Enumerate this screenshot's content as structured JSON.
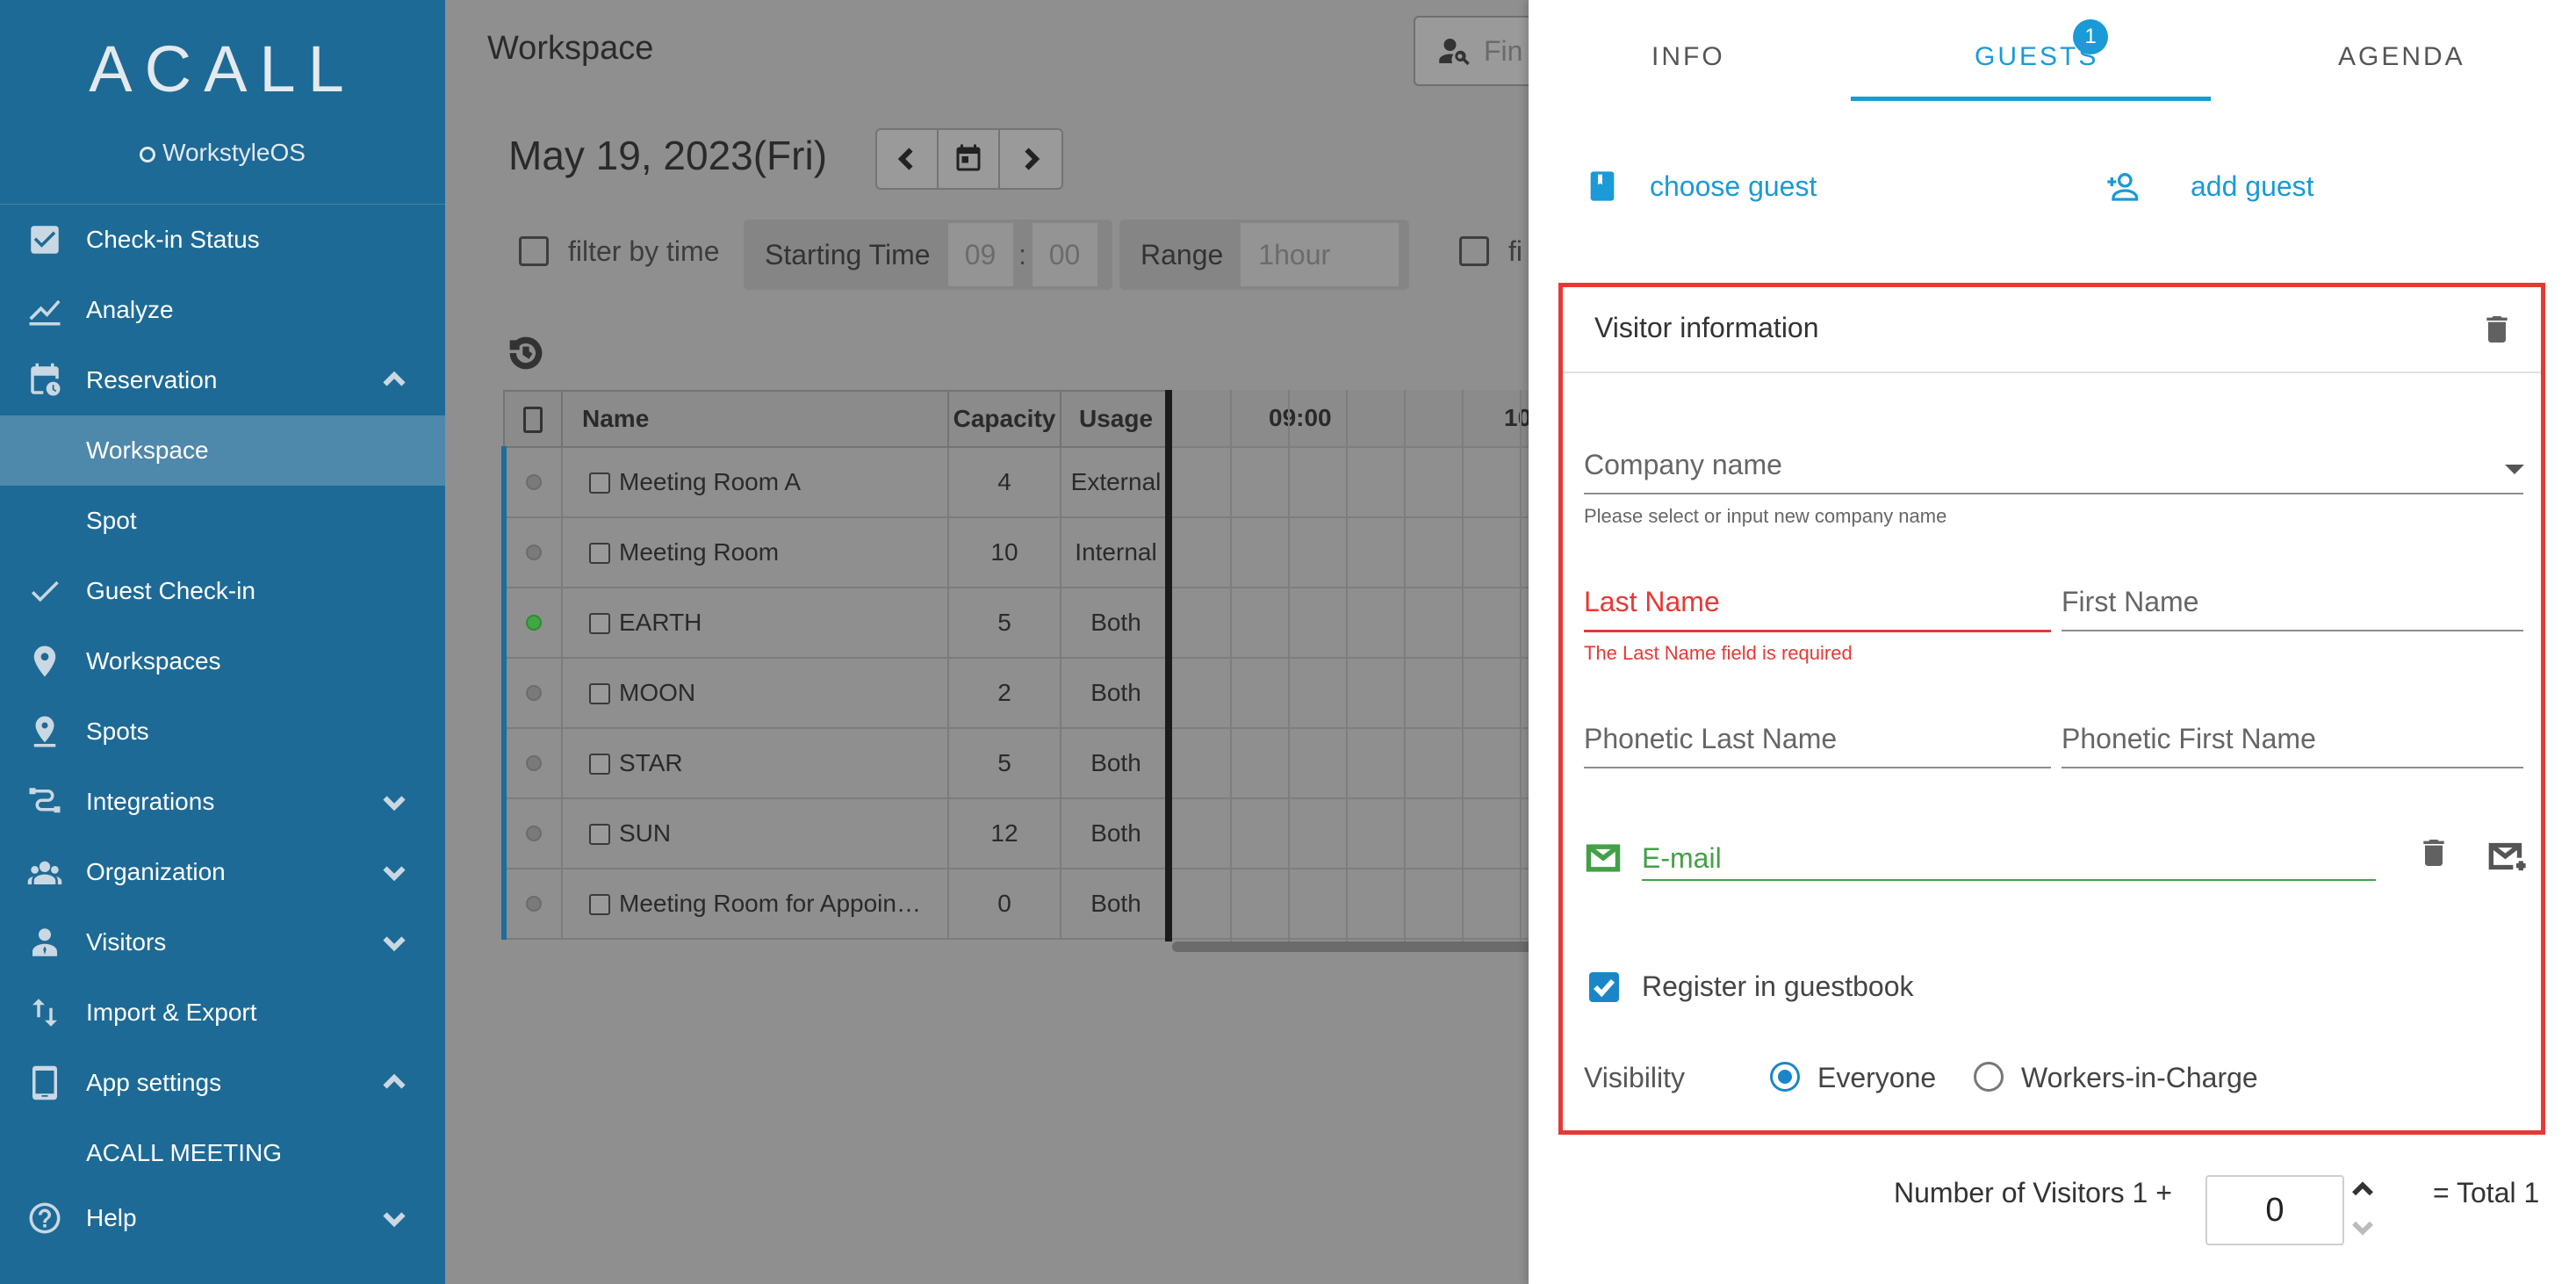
{
  "sidebar": {
    "logo": "ACALL",
    "sublogo": "WorkstyleOS",
    "items": [
      {
        "label": "Check-in Status",
        "icon": "checkbox-icon"
      },
      {
        "label": "Analyze",
        "icon": "chart-line-icon"
      },
      {
        "label": "Reservation",
        "icon": "calendar-clock-icon",
        "chevron": "up"
      },
      {
        "label": "Workspace",
        "sub": true,
        "active": true
      },
      {
        "label": "Spot",
        "sub": true
      },
      {
        "label": "Guest Check-in",
        "icon": "check-icon"
      },
      {
        "label": "Workspaces",
        "icon": "map-pin-icon"
      },
      {
        "label": "Spots",
        "icon": "person-pin-icon"
      },
      {
        "label": "Integrations",
        "icon": "integrations-icon",
        "chevron": "down"
      },
      {
        "label": "Organization",
        "icon": "group-icon",
        "chevron": "down"
      },
      {
        "label": "Visitors",
        "icon": "visitor-icon",
        "chevron": "down"
      },
      {
        "label": "Import & Export",
        "icon": "import-export-icon"
      },
      {
        "label": "App settings",
        "icon": "tablet-icon",
        "chevron": "up"
      },
      {
        "label": "ACALL MEETING",
        "sub": true
      },
      {
        "label": "Help",
        "icon": "help-icon",
        "chevron": "down"
      }
    ]
  },
  "main": {
    "title": "Workspace",
    "search_placeholder": "Fin",
    "date": "May 19, 2023(Fri)",
    "filter_by_time": "filter by time",
    "starting_time_label": "Starting Time",
    "start_hour": "09",
    "start_sep": ":",
    "start_min": "00",
    "range_label": "Range",
    "range_value": "1hour",
    "filter_cut": "fi",
    "table": {
      "headers": [
        "Name",
        "Capacity",
        "Usage"
      ],
      "time_header": "09:00",
      "time_header2": "10",
      "rows": [
        {
          "name": "Meeting Room A",
          "capacity": "4",
          "usage": "External",
          "status": "grey"
        },
        {
          "name": "Meeting Room",
          "capacity": "10",
          "usage": "Internal",
          "status": "grey"
        },
        {
          "name": "EARTH",
          "capacity": "5",
          "usage": "Both",
          "status": "green"
        },
        {
          "name": "MOON",
          "capacity": "2",
          "usage": "Both",
          "status": "grey"
        },
        {
          "name": "STAR",
          "capacity": "5",
          "usage": "Both",
          "status": "grey"
        },
        {
          "name": "SUN",
          "capacity": "12",
          "usage": "Both",
          "status": "grey"
        },
        {
          "name": "Meeting Room for Appoin…",
          "capacity": "0",
          "usage": "Both",
          "status": "grey"
        }
      ]
    }
  },
  "panel": {
    "tabs": [
      {
        "label": "INFO",
        "active": false
      },
      {
        "label": "GUESTS",
        "active": true,
        "badge": "1"
      },
      {
        "label": "AGENDA",
        "active": false
      }
    ],
    "choose_guest": "choose guest",
    "add_guest": "add guest",
    "visitor_card": {
      "title": "Visitor information",
      "company_label": "Company name",
      "company_hint": "Please select or input new company name",
      "last_name_label": "Last Name",
      "last_name_error": "The Last Name field is required",
      "first_name_label": "First Name",
      "phonetic_last_label": "Phonetic Last Name",
      "phonetic_first_label": "Phonetic First Name",
      "email_label": "E-mail",
      "register_label": "Register in guestbook",
      "register_checked": true,
      "visibility_label": "Visibility",
      "visibility_options": [
        "Everyone",
        "Workers-in-Charge"
      ],
      "visibility_selected": "Everyone"
    },
    "visitors_label": "Number of Visitors 1 +",
    "visitors_value": "0",
    "total_label": "= Total 1"
  },
  "colors": {
    "sidebar_bg": "#1d6a96",
    "accent": "#1a9ad6",
    "error": "#e53935",
    "success": "#43a047"
  }
}
